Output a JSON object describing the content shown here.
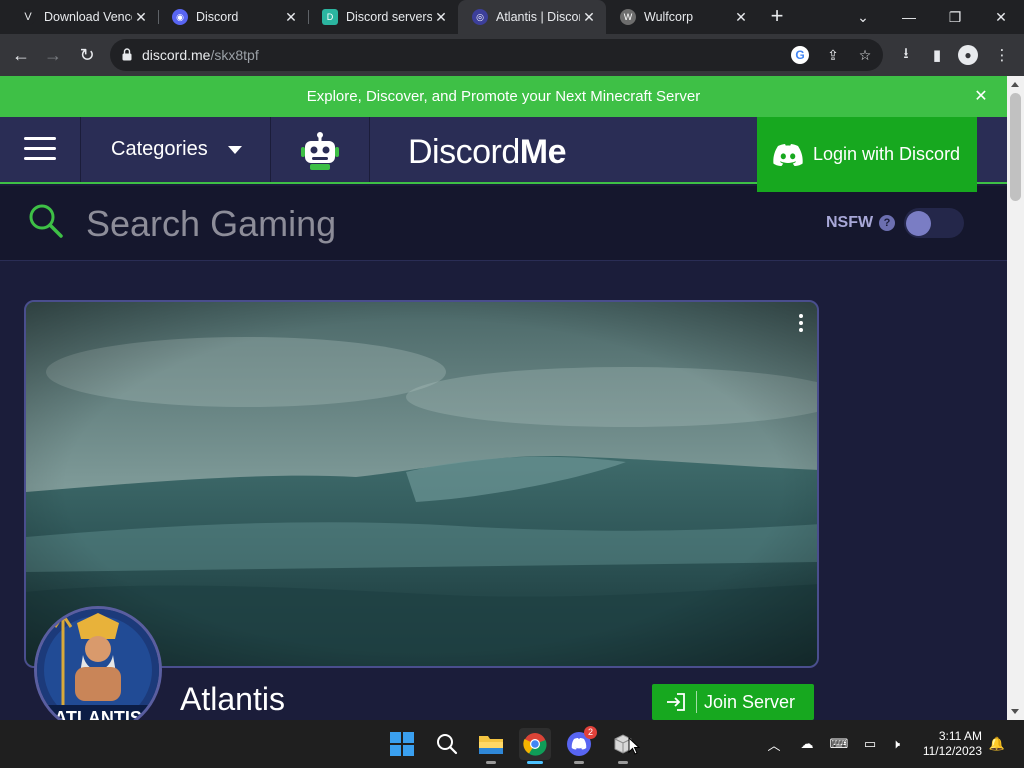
{
  "browser": {
    "tabs": [
      {
        "title": "Download Vencord",
        "favicon": "vencord-icon",
        "color": "#202124",
        "glyph": "V"
      },
      {
        "title": "Discord",
        "favicon": "discord-icon",
        "color": "#5865f2",
        "glyph": "◉"
      },
      {
        "title": "Discord servers",
        "favicon": "discordservers-icon",
        "color": "#2bb5a0",
        "glyph": "D"
      },
      {
        "title": "Atlantis | Discord Me",
        "favicon": "discordme-icon",
        "color": "#3c3f9a",
        "glyph": "◎"
      },
      {
        "title": "Wulfcorp",
        "favicon": "wulfcorp-icon",
        "color": "#6d6d6d",
        "glyph": "W"
      }
    ],
    "active_tab": 3,
    "url_host": "discord.me",
    "url_path": "/skx8tpf"
  },
  "page": {
    "banner_text": "Explore, Discover, and Promote your Next Minecraft Server",
    "categories_label": "Categories",
    "logo_light": "Discord",
    "logo_bold": "Me",
    "login_label": "Login with Discord",
    "search_placeholder": "Search Gaming",
    "nsfw_label": "NSFW",
    "nsfw_help": "?",
    "nsfw_enabled": false,
    "server_name": "Atlantis",
    "avatar_text": "ATLANTIS",
    "join_label": "Join Server"
  },
  "taskbar": {
    "discord_badge": "2",
    "time": "3:11 AM",
    "date": "11/12/2023"
  },
  "colors": {
    "banner": "#3ec046",
    "navbar": "#2a2d55",
    "page_bg": "#1b1d3a",
    "accent_green": "#17a81f"
  }
}
